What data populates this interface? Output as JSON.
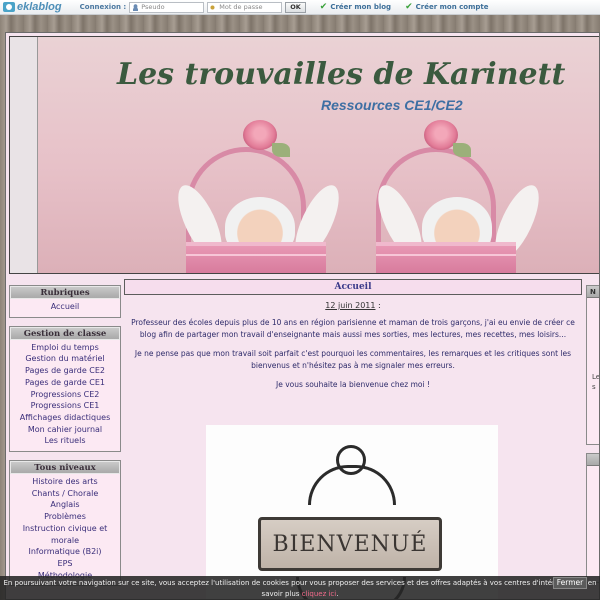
{
  "topbar": {
    "logo_text": "eklablog",
    "connexion_label": "Connexion :",
    "pseudo_placeholder": "Pseudo",
    "password_placeholder": "Mot de passe",
    "ok_label": "OK",
    "create_blog_label": "Créer mon blog",
    "create_account_label": "Créer mon compte"
  },
  "header": {
    "title": "Les trouvailles de Karinett",
    "subtitle": "Ressources CE1/CE2"
  },
  "sidebar": {
    "blocks": [
      {
        "title": "Rubriques",
        "items": [
          "Accueil"
        ]
      },
      {
        "title": "Gestion de classe",
        "items": [
          "Emploi du temps",
          "Gestion du matériel",
          "Pages de garde CE2",
          "Pages de garde CE1",
          "Progressions CE2",
          "Progressions CE1",
          "Affichages didactiques",
          "Mon cahier journal",
          "Les rituels"
        ]
      },
      {
        "title": "Tous niveaux",
        "items": [
          "Histoire des arts",
          "Chants / Chorale",
          "Anglais",
          "Problèmes",
          "Instruction civique et",
          "morale",
          "Informatique (B2i)",
          "EPS",
          "Méthodologie"
        ]
      }
    ]
  },
  "main": {
    "title": "Accueil",
    "post_date": "12 juin 2011",
    "post_date_suffix": " :",
    "paragraphs": [
      "Professeur des écoles depuis plus de 10 ans en région parisienne et maman de trois garçons, j'ai eu envie de créer ce blog afin de partager mon travail d'enseignante mais aussi mes sorties, mes lectures, mes recettes, mes loisirs...",
      "Je ne pense pas que mon travail soit parfait c'est pourquoi les commentaires, les remarques et les critiques sont les bienvenus et n'hésitez pas à me signaler mes erreurs.",
      "Je vous souhaite la bienvenue chez moi !"
    ],
    "image_text": "BIENVENUÉ"
  },
  "right_sidebar": {
    "block1_title": "N",
    "block1_text": "Le",
    "block1_text2": "s"
  },
  "cookie": {
    "text": "En poursuivant votre navigation sur ce site, vous acceptez l'utilisation de cookies pour vous proposer des services et des offres adaptés à vos centres d'intérêts. Pour en savoir plus ",
    "link": "cliquez ici",
    "end": ".",
    "button": "Fermer"
  }
}
